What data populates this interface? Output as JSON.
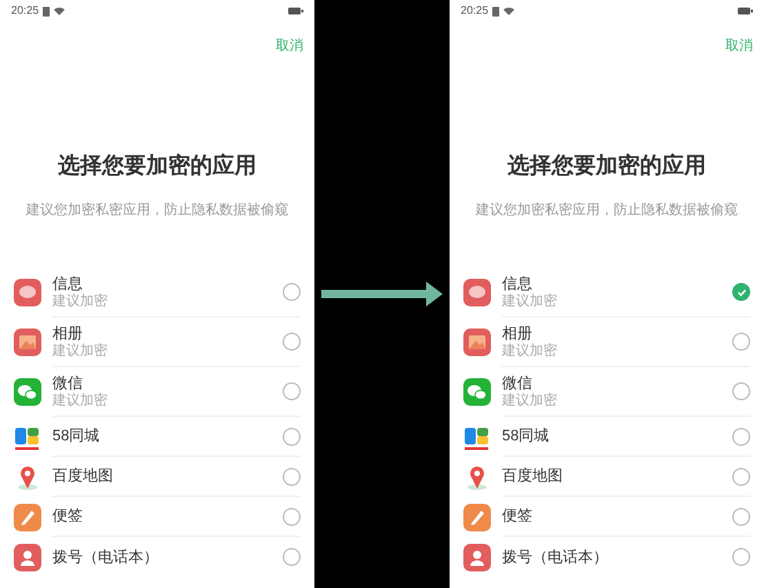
{
  "screens": [
    {
      "status_bar": {
        "time": "20:25"
      },
      "cancel": "取消",
      "title": "选择您要加密的应用",
      "subtitle": "建议您加密私密应用，防止隐私数据被偷窥",
      "apps": [
        {
          "kind": "message",
          "name": "信息",
          "hint": "建议加密",
          "selected": false
        },
        {
          "kind": "gallery",
          "name": "相册",
          "hint": "建议加密",
          "selected": false
        },
        {
          "kind": "wechat",
          "name": "微信",
          "hint": "建议加密",
          "selected": false
        },
        {
          "kind": "city58",
          "name": "58同城",
          "selected": false
        },
        {
          "kind": "map",
          "name": "百度地图",
          "selected": false
        },
        {
          "kind": "note",
          "name": "便签",
          "selected": false
        },
        {
          "kind": "phone",
          "name": "拨号（电话本）",
          "selected": false
        }
      ]
    },
    {
      "status_bar": {
        "time": "20:25"
      },
      "cancel": "取消",
      "title": "选择您要加密的应用",
      "subtitle": "建议您加密私密应用，防止隐私数据被偷窥",
      "apps": [
        {
          "kind": "message",
          "name": "信息",
          "hint": "建议加密",
          "selected": true
        },
        {
          "kind": "gallery",
          "name": "相册",
          "hint": "建议加密",
          "selected": false
        },
        {
          "kind": "wechat",
          "name": "微信",
          "hint": "建议加密",
          "selected": false
        },
        {
          "kind": "city58",
          "name": "58同城",
          "selected": false
        },
        {
          "kind": "map",
          "name": "百度地图",
          "selected": false
        },
        {
          "kind": "note",
          "name": "便签",
          "selected": false
        },
        {
          "kind": "phone",
          "name": "拨号（电话本）",
          "selected": false
        }
      ]
    }
  ]
}
